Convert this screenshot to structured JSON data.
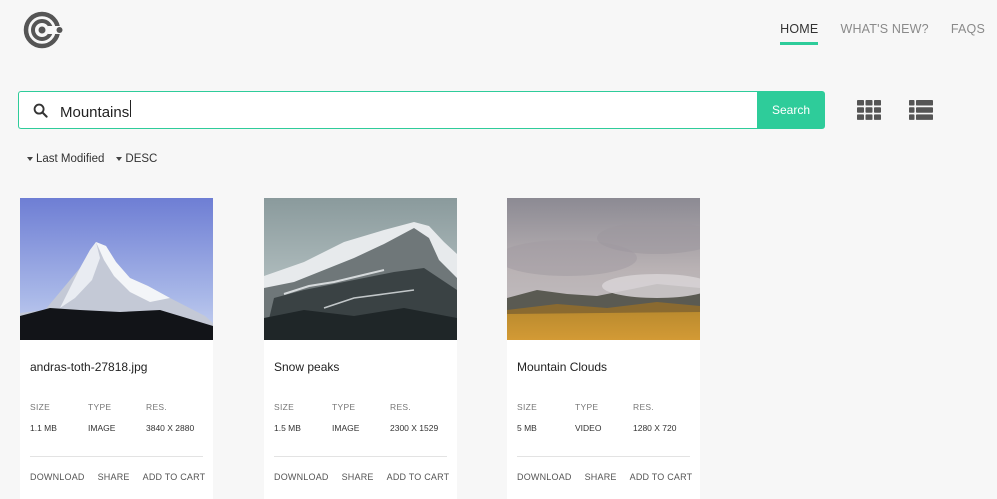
{
  "brand": {
    "logo_icon": "target-logo-icon",
    "accent": "#2ecc9a"
  },
  "nav": [
    {
      "label": "HOME",
      "active": true
    },
    {
      "label": "WHAT'S NEW?",
      "active": false
    },
    {
      "label": "FAQS",
      "active": false
    }
  ],
  "search": {
    "value": "Mountains",
    "button_label": "Search",
    "icon": "search-icon"
  },
  "view_toggles": [
    "grid-view-icon",
    "list-view-icon"
  ],
  "sort": {
    "field": "Last Modified",
    "order": "DESC"
  },
  "cards": [
    {
      "title": "andras-toth-27818.jpg",
      "labels": [
        "SIZE",
        "TYPE",
        "RES."
      ],
      "size": "1.1 MB",
      "type": "IMAGE",
      "res": "3840 X 2880",
      "actions": [
        "DOWNLOAD",
        "SHARE",
        "ADD TO CART"
      ]
    },
    {
      "title": "Snow peaks",
      "labels": [
        "SIZE",
        "TYPE",
        "RES."
      ],
      "size": "1.5 MB",
      "type": "IMAGE",
      "res": "2300 X 1529",
      "actions": [
        "DOWNLOAD",
        "SHARE",
        "ADD TO CART"
      ]
    },
    {
      "title": "Mountain Clouds",
      "labels": [
        "SIZE",
        "TYPE",
        "RES."
      ],
      "size": "5 MB",
      "type": "VIDEO",
      "res": "1280 X 720",
      "actions": [
        "DOWNLOAD",
        "SHARE",
        "ADD TO CART"
      ]
    }
  ]
}
